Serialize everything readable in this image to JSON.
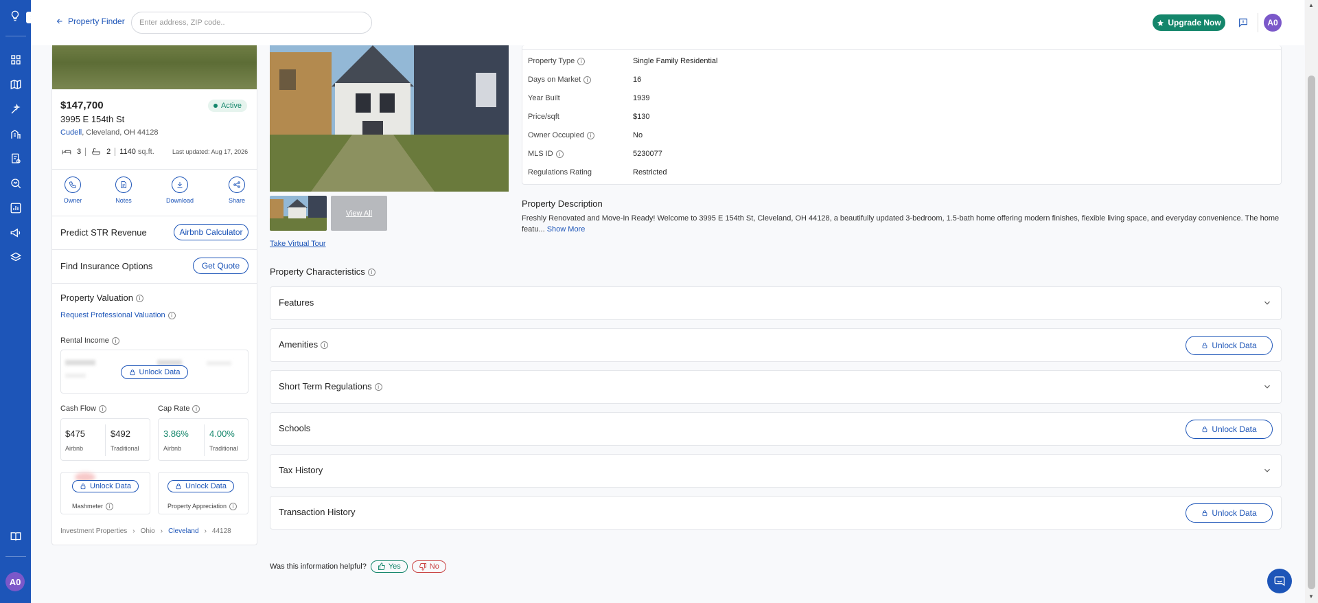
{
  "rail": {
    "logo": "lightbulb-icon",
    "expand": "chevron-right-icon",
    "items": [
      "dashboard-icon",
      "map-icon",
      "sparkles-icon",
      "buildings-icon",
      "report-icon",
      "search-analytics-icon",
      "chart-icon",
      "megaphone-icon",
      "layers-icon"
    ],
    "bottom": [
      "book-icon"
    ],
    "avatar": "A0"
  },
  "header": {
    "back_label": "Property Finder",
    "search_placeholder": "Enter address, ZIP code..",
    "upgrade_label": "Upgrade Now",
    "avatar": "A0",
    "accent": "#14866b"
  },
  "listing": {
    "price": "$147,700",
    "status": "Active",
    "address": "3995 E 154th St",
    "neighborhood": "Cudell",
    "city_line": ", Cleveland, OH 44128",
    "beds": "3",
    "baths": "2",
    "sqft": "1140",
    "sqft_unit": "sq.ft.",
    "last_updated": "Last updated: Aug 17, 2026",
    "actions": [
      {
        "label": "Owner",
        "icon": "phone-icon"
      },
      {
        "label": "Notes",
        "icon": "notes-icon"
      },
      {
        "label": "Download",
        "icon": "download-icon"
      },
      {
        "label": "Share",
        "icon": "share-icon"
      }
    ]
  },
  "predict": {
    "title": "Predict STR Revenue",
    "button": "Airbnb Calculator"
  },
  "insurance": {
    "title": "Find Insurance Options",
    "button": "Get Quote"
  },
  "valuation": {
    "title": "Property Valuation",
    "request_link": "Request Professional Valuation",
    "rental_income_label": "Rental Income",
    "unlock": "Unlock Data",
    "cash_flow": {
      "label": "Cash Flow",
      "airbnb": "$475",
      "traditional": "$492",
      "airbnb_label": "Airbnb",
      "traditional_label": "Traditional"
    },
    "cap_rate": {
      "label": "Cap Rate",
      "airbnb": "3.86%",
      "traditional": "4.00%",
      "airbnb_label": "Airbnb",
      "traditional_label": "Traditional"
    },
    "mashmeter_label": "Mashmeter",
    "appreciation_label": "Property Appreciation"
  },
  "breadcrumb": {
    "items": [
      "Investment Properties",
      "Ohio",
      "Cleveland",
      "44128"
    ]
  },
  "gallery": {
    "view_all": "View All",
    "virtual_tour": "Take Virtual Tour"
  },
  "details": {
    "rows": [
      {
        "label": "Property Type",
        "value": "Single Family Residential",
        "info": true
      },
      {
        "label": "Days on Market",
        "value": "16",
        "info": true
      },
      {
        "label": "Year Built",
        "value": "1939",
        "info": false
      },
      {
        "label": "Price/sqft",
        "value": "$130",
        "info": false
      },
      {
        "label": "Owner Occupied",
        "value": "No",
        "info": true
      },
      {
        "label": "MLS ID",
        "value": "5230077",
        "info": true
      },
      {
        "label": "Regulations Rating",
        "value": "Restricted",
        "info": false
      }
    ]
  },
  "description": {
    "title": "Property Description",
    "text": "Freshly Renovated and Move-In Ready! Welcome to 3995 E 154th St, Cleveland, OH 44128, a beautifully updated 3-bedroom, 1.5-bath home offering modern finishes, flexible living space, and everyday convenience. The home featu...",
    "show_more": "Show More"
  },
  "characteristics": {
    "title": "Property Characteristics",
    "sections": [
      {
        "title": "Features",
        "info": false,
        "locked": false
      },
      {
        "title": "Amenities",
        "info": true,
        "locked": true
      },
      {
        "title": "Short Term Regulations",
        "info": true,
        "locked": false
      },
      {
        "title": "Schools",
        "info": false,
        "locked": true
      },
      {
        "title": "Tax History",
        "info": false,
        "locked": false
      },
      {
        "title": "Transaction History",
        "info": false,
        "locked": true
      }
    ],
    "unlock_label": "Unlock Data"
  },
  "feedback": {
    "question": "Was this information helpful?",
    "yes": "Yes",
    "no": "No"
  }
}
